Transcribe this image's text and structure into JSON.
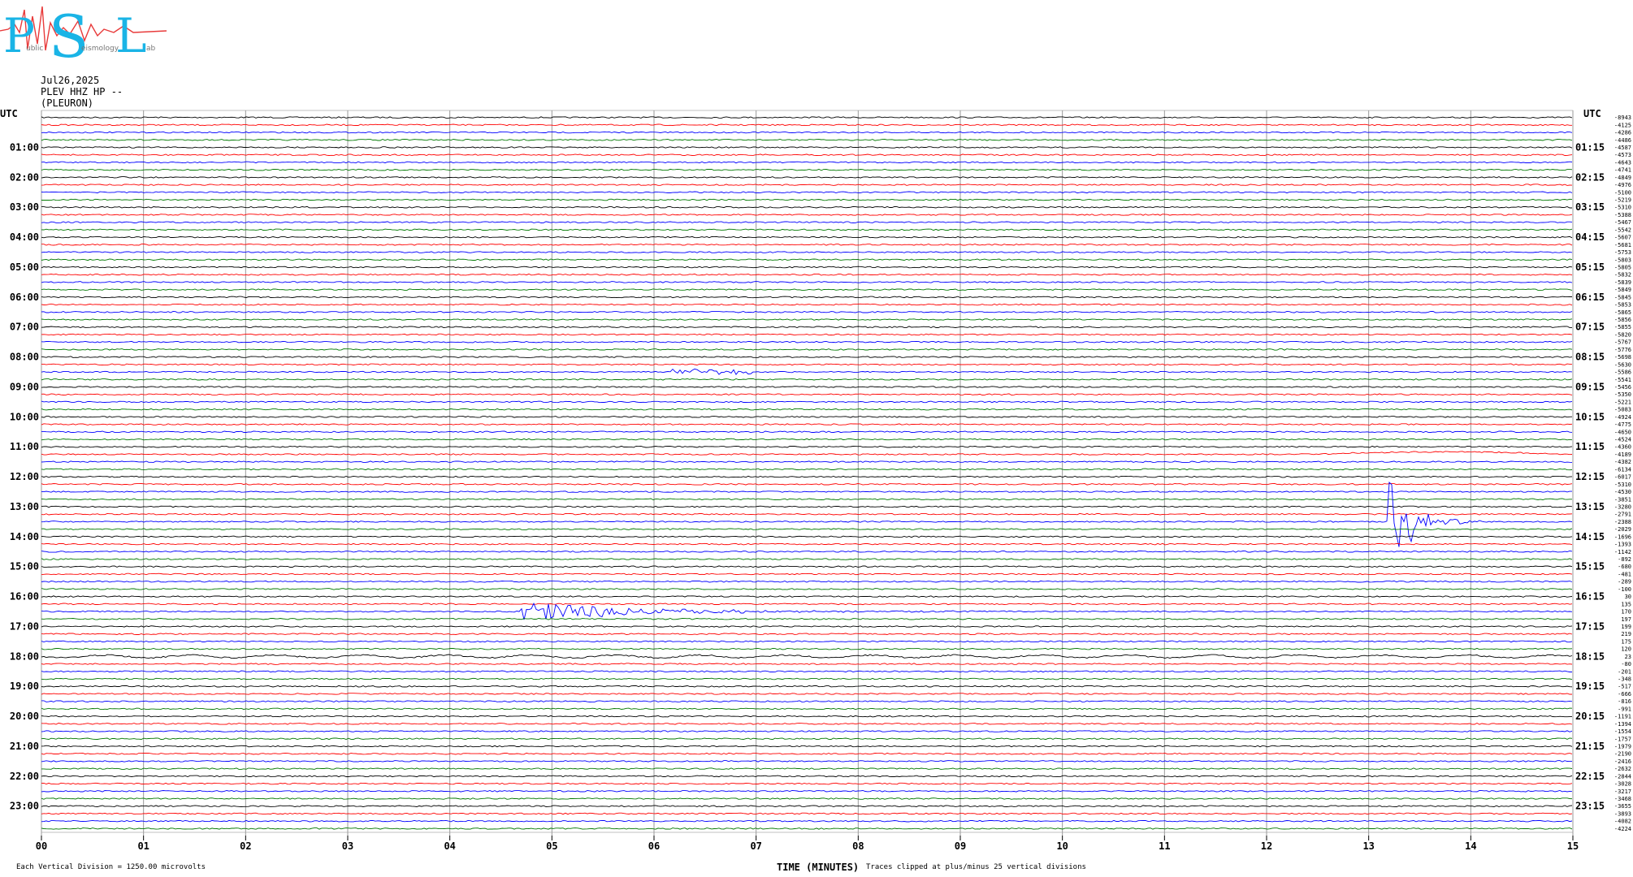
{
  "logo": {
    "letters": [
      "P",
      "S",
      "L"
    ],
    "words": [
      "ublic",
      "eismology",
      "ab"
    ],
    "colors": {
      "letters": "#1ab4e6",
      "trace": "#e83a3a"
    }
  },
  "header": {
    "date": "Jul26,2025",
    "station": "PLEV HHZ HP --",
    "location": "(PLEURON)"
  },
  "chart_data": {
    "type": "line",
    "description_axis": "helicorder",
    "left_axis_label": "UTC",
    "right_axis_label": "UTC",
    "left_hour_labels": [
      "01:00",
      "02:00",
      "03:00",
      "04:00",
      "05:00",
      "06:00",
      "07:00",
      "08:00",
      "09:00",
      "10:00",
      "11:00",
      "12:00",
      "13:00",
      "14:00",
      "15:00",
      "16:00",
      "17:00",
      "18:00",
      "19:00",
      "20:00",
      "21:00",
      "22:00",
      "23:00"
    ],
    "right_hour_labels": [
      "01:15",
      "02:15",
      "03:15",
      "04:15",
      "05:15",
      "06:15",
      "07:15",
      "08:15",
      "09:15",
      "10:15",
      "11:15",
      "12:15",
      "13:15",
      "14:15",
      "15:15",
      "16:15",
      "17:15",
      "18:15",
      "19:15",
      "20:15",
      "21:15",
      "22:15",
      "23:15"
    ],
    "x_ticks": [
      "00",
      "01",
      "02",
      "03",
      "04",
      "05",
      "06",
      "07",
      "08",
      "09",
      "10",
      "11",
      "12",
      "13",
      "14",
      "15"
    ],
    "xlabel": "TIME (MINUTES)",
    "xlim": [
      0,
      15
    ],
    "rows": 96,
    "row_colors": [
      "#000000",
      "#ff0000",
      "#0000ff",
      "#007700"
    ],
    "grid_color": "#9a9a9a",
    "row_offsets": [
      "-8943",
      "-4125",
      "-4286",
      "-4486",
      "-4587",
      "-4573",
      "-4643",
      "-4741",
      "-4849",
      "-4976",
      "-5100",
      "-5219",
      "-5310",
      "-5388",
      "-5467",
      "-5542",
      "-5607",
      "-5681",
      "-5753",
      "-5803",
      "-5805",
      "-5832",
      "-5839",
      "-5849",
      "-5845",
      "-5853",
      "-5865",
      "-5856",
      "-5855",
      "-5820",
      "-5767",
      "-5776",
      "-5698",
      "-5630",
      "-5586",
      "-5541",
      "-5456",
      "-5350",
      "-5221",
      "-5083",
      "-4924",
      "-4775",
      "-4650",
      "-4524",
      "-4360",
      "-4189",
      "-4382",
      "-6134",
      "-6017",
      "-5310",
      "-4530",
      "-3851",
      "-3280",
      "-2791",
      "-2388",
      "-2029",
      "-1696",
      "-1393",
      "-1142",
      "-892",
      "-680",
      "-481",
      "-289",
      "-100",
      "30",
      "135",
      "170",
      "197",
      "199",
      "219",
      "175",
      "120",
      "23",
      "-80",
      "-201",
      "-348",
      "-517",
      "-666",
      "-816",
      "-991",
      "-1191",
      "-1394",
      "-1554",
      "-1757",
      "-1979",
      "-2190",
      "-2416",
      "-2632",
      "-2844",
      "-3028",
      "-3217",
      "-3468",
      "-3655",
      "-3893",
      "-4082",
      "-4224"
    ],
    "events": [
      {
        "row": 34,
        "start_min": 6.15,
        "end_min": 6.95,
        "amplitude": 0.35,
        "decay": 0,
        "color_index": 3
      },
      {
        "row": 45,
        "start_min": 12.4,
        "end_min": 15.0,
        "amplitude": 0.5,
        "decay": 0,
        "color_index": 1,
        "kind": "drift"
      },
      {
        "row": 54,
        "start_min": 13.2,
        "end_min": 14.1,
        "amplitude": 6.5,
        "decay": 4.5,
        "color_index": 2
      },
      {
        "row": 66,
        "start_min": 4.7,
        "end_min": 9.5,
        "amplitude": 1.3,
        "decay": 0.9,
        "color_index": 2
      },
      {
        "row": 72,
        "start_min": 0.0,
        "end_min": 15.0,
        "amplitude": 0.8,
        "decay": 0,
        "color_index": 0,
        "kind": "swell"
      }
    ],
    "annotations": {
      "left_footer": "Each Vertical Division = 1250.00 microvolts",
      "right_footer": "Traces clipped at plus/minus 25 vertical divisions"
    }
  }
}
